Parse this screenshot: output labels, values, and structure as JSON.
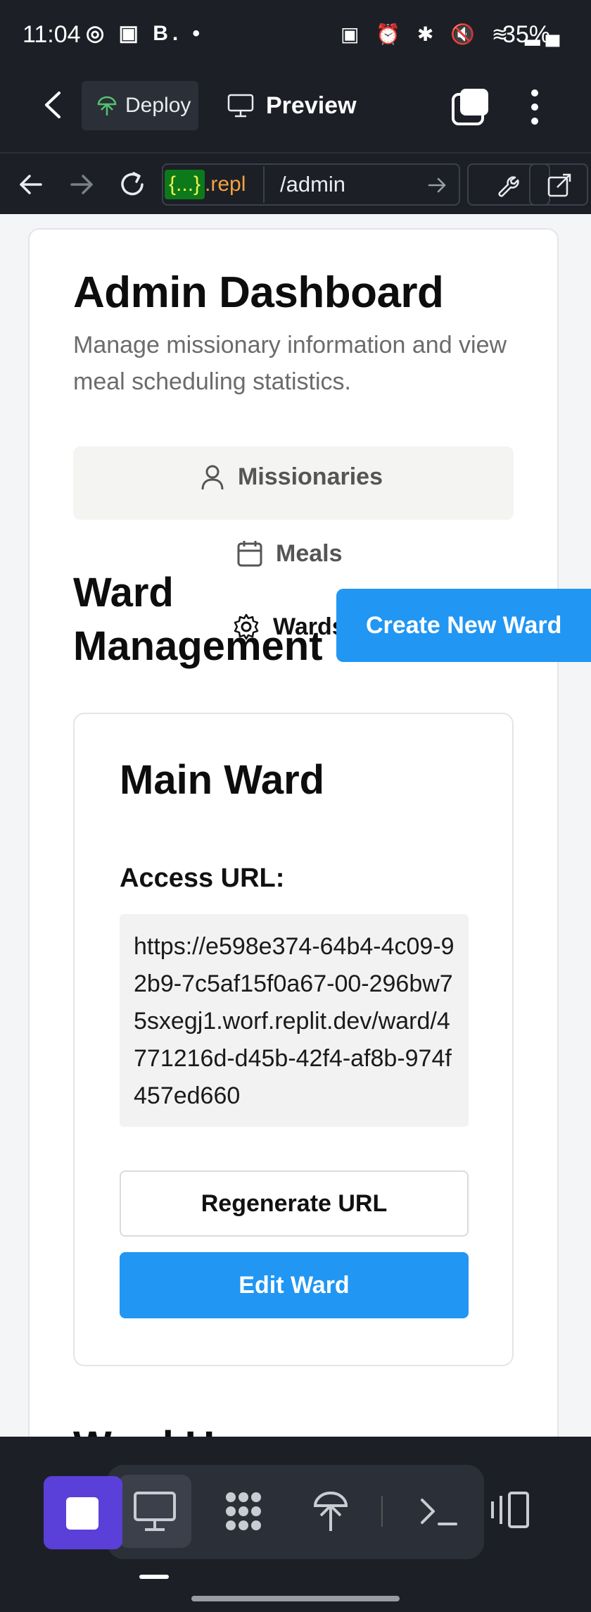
{
  "status_bar": {
    "time": "11:04",
    "left_icons": "◎ ▣ B. •",
    "right_icons": "▣ ⏰ ✱ 🔇 ≋ ▂▄",
    "battery": "35%"
  },
  "topbar": {
    "deploy_label": "Deploy",
    "preview_label": "Preview"
  },
  "urlbar": {
    "chip_braces": "{...}",
    "chip_repl": ".repl",
    "path": "/admin"
  },
  "page": {
    "title": "Admin Dashboard",
    "subtitle": "Manage missionary information and view meal scheduling statistics.",
    "tabs": {
      "missionaries": "Missionaries",
      "meals": "Meals",
      "wards": "Wards"
    },
    "section_title": "Ward Management",
    "create_button": "Create New Ward",
    "ward": {
      "name": "Main Ward",
      "access_label": "Access URL:",
      "access_url": "https://e598e374-64b4-4c09-92b9-7c5af15f0a67-00-296bw75sxegj1.worf.replit.dev/ward/4771216d-d45b-42f4-af8b-974f457ed660",
      "regenerate_button": "Regenerate URL",
      "edit_button": "Edit Ward"
    },
    "next_heading_partial": "Ward U"
  },
  "colors": {
    "accent": "#2196f3",
    "stop_button": "#5b3fd9",
    "chrome_bg": "#1c1f26"
  }
}
